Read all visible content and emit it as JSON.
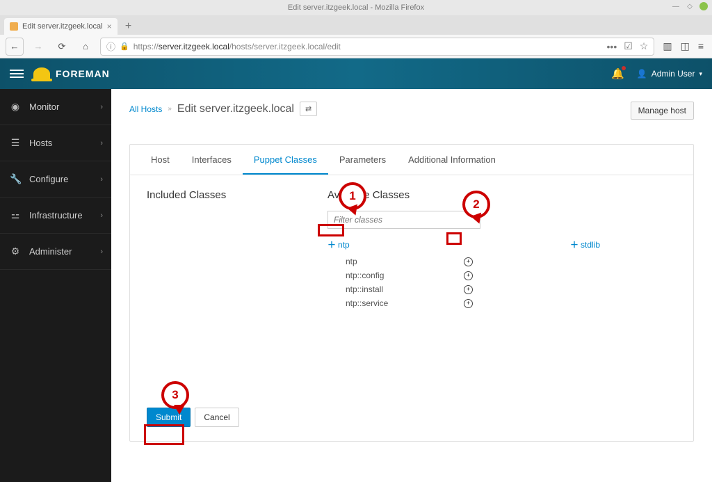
{
  "window": {
    "title": "Edit server.itzgeek.local - Mozilla Firefox"
  },
  "browser": {
    "tab_title": "Edit server.itzgeek.local",
    "url_prefix": "https://",
    "url_host": "server.itzgeek.local",
    "url_path": "/hosts/server.itzgeek.local/edit"
  },
  "header": {
    "brand": "FOREMAN",
    "user_label": "Admin User"
  },
  "sidebar": {
    "items": [
      {
        "icon": "📊",
        "label": "Monitor"
      },
      {
        "icon": "🖧",
        "label": "Hosts"
      },
      {
        "icon": "🔧",
        "label": "Configure"
      },
      {
        "icon": "🏗",
        "label": "Infrastructure"
      },
      {
        "icon": "⚙",
        "label": "Administer"
      }
    ]
  },
  "breadcrumb": {
    "parent": "All Hosts",
    "title": "Edit server.itzgeek.local",
    "manage_btn": "Manage host"
  },
  "tabs": {
    "items": [
      "Host",
      "Interfaces",
      "Puppet Classes",
      "Parameters",
      "Additional Information"
    ],
    "active_index": 2
  },
  "puppet": {
    "included_heading": "Included Classes",
    "available_heading": "Available Classes",
    "filter_placeholder": "Filter classes",
    "group1": {
      "name": "ntp",
      "subclasses": [
        "ntp",
        "ntp::config",
        "ntp::install",
        "ntp::service"
      ]
    },
    "group2": {
      "name": "stdlib"
    }
  },
  "actions": {
    "submit": "Submit",
    "cancel": "Cancel"
  },
  "annotations": {
    "c1": "1",
    "c2": "2",
    "c3": "3"
  }
}
